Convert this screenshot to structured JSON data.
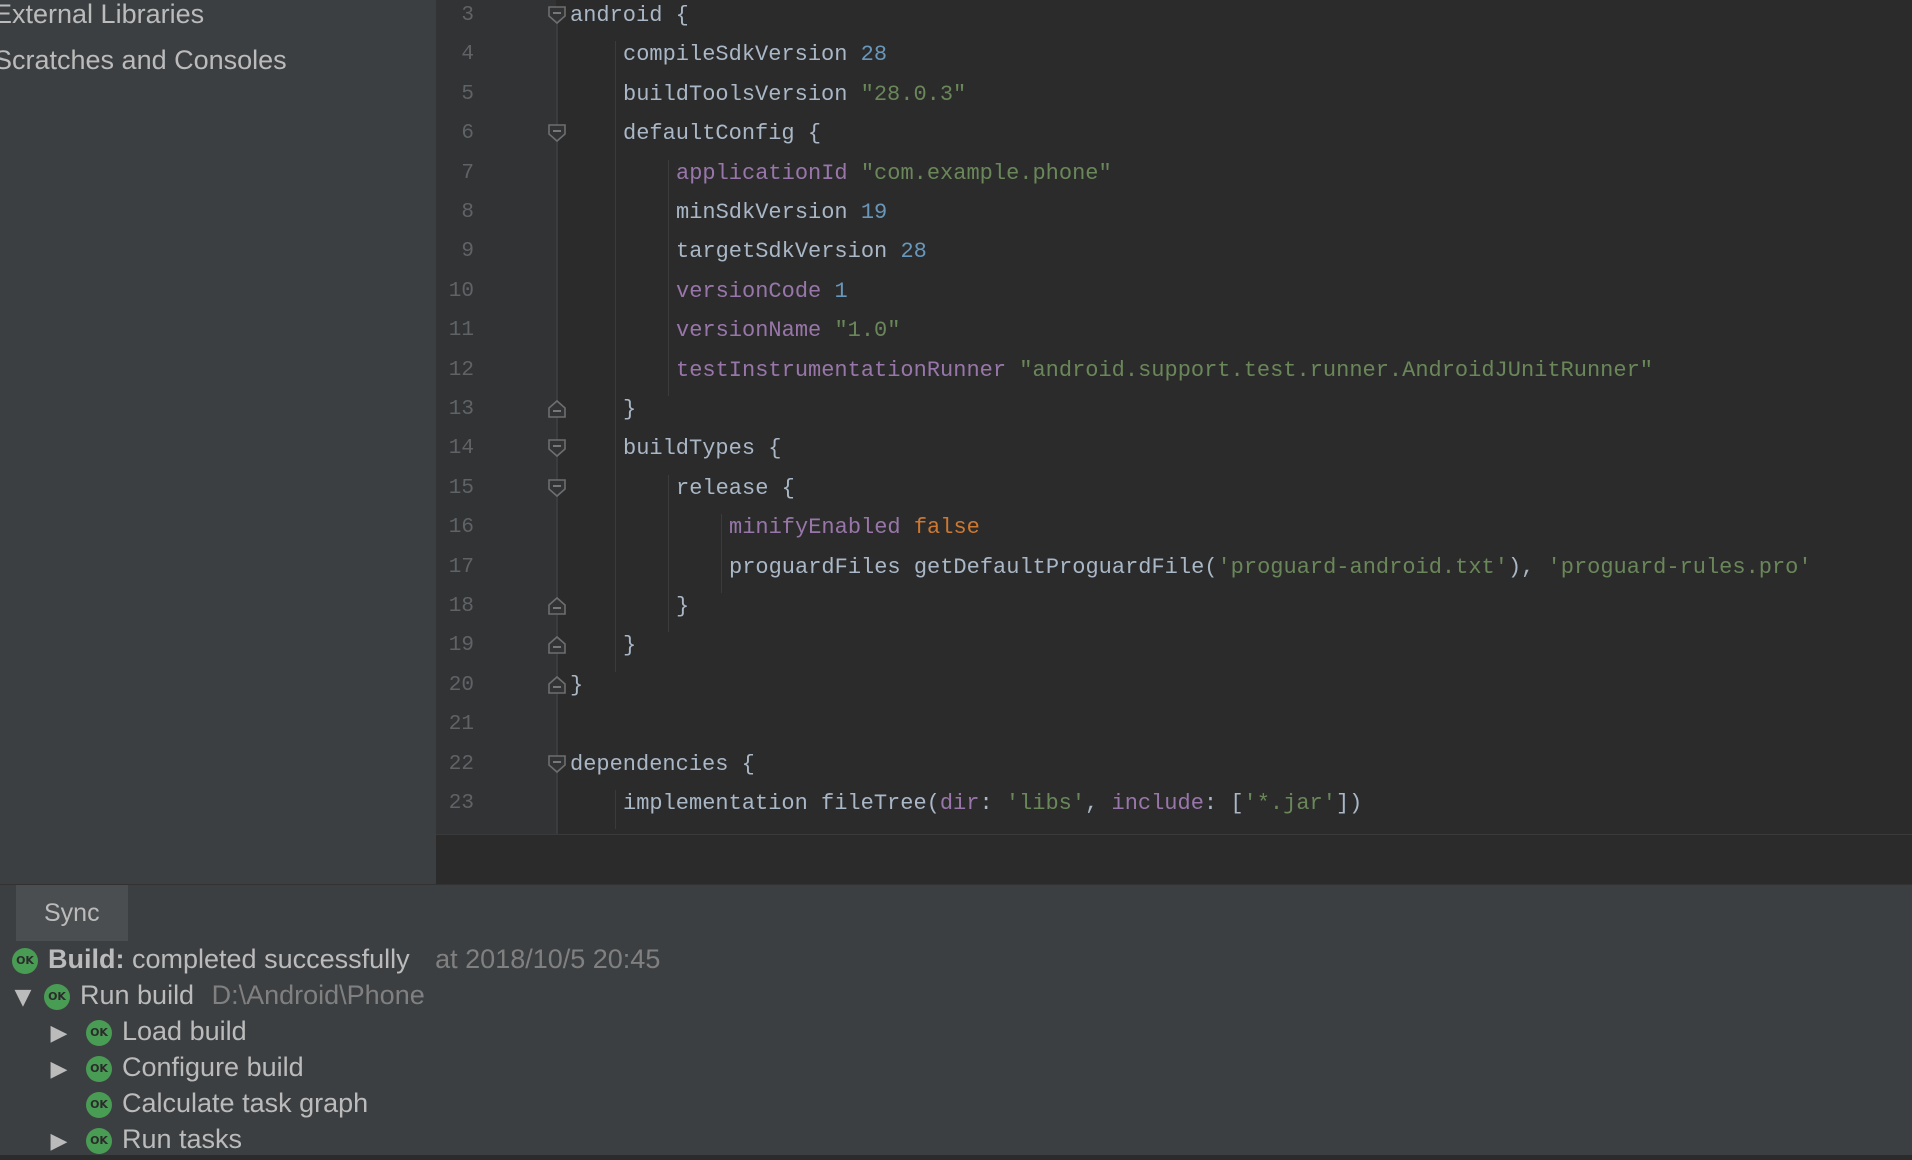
{
  "sidebar": {
    "items": [
      {
        "label": "External Libraries"
      },
      {
        "label": "Scratches and Consoles"
      }
    ]
  },
  "editor": {
    "lines": [
      {
        "n": "3",
        "indent": 0,
        "tokens": [
          [
            "kw",
            "android {"
          ]
        ],
        "fold": "open"
      },
      {
        "n": "4",
        "indent": 1,
        "tokens": [
          [
            "kw",
            "compileSdkVersion "
          ],
          [
            "num",
            "28"
          ]
        ]
      },
      {
        "n": "5",
        "indent": 1,
        "tokens": [
          [
            "kw",
            "buildToolsVersion "
          ],
          [
            "str",
            "\"28.0.3\""
          ]
        ]
      },
      {
        "n": "6",
        "indent": 1,
        "tokens": [
          [
            "kw",
            "defaultConfig {"
          ]
        ],
        "fold": "open"
      },
      {
        "n": "7",
        "indent": 2,
        "tokens": [
          [
            "prop",
            "applicationId "
          ],
          [
            "str",
            "\"com.example.phone\""
          ]
        ]
      },
      {
        "n": "8",
        "indent": 2,
        "tokens": [
          [
            "kw",
            "minSdkVersion "
          ],
          [
            "num",
            "19"
          ]
        ]
      },
      {
        "n": "9",
        "indent": 2,
        "tokens": [
          [
            "kw",
            "targetSdkVersion "
          ],
          [
            "num",
            "28"
          ]
        ]
      },
      {
        "n": "10",
        "indent": 2,
        "tokens": [
          [
            "prop",
            "versionCode "
          ],
          [
            "num",
            "1"
          ]
        ]
      },
      {
        "n": "11",
        "indent": 2,
        "tokens": [
          [
            "prop",
            "versionName "
          ],
          [
            "str",
            "\"1.0\""
          ]
        ]
      },
      {
        "n": "12",
        "indent": 2,
        "tokens": [
          [
            "prop",
            "testInstrumentationRunner "
          ],
          [
            "str",
            "\"android.support.test.runner.AndroidJUnitRunner\""
          ]
        ]
      },
      {
        "n": "13",
        "indent": 1,
        "tokens": [
          [
            "kw",
            "}"
          ]
        ],
        "fold": "close"
      },
      {
        "n": "14",
        "indent": 1,
        "tokens": [
          [
            "kw",
            "buildTypes {"
          ]
        ],
        "fold": "open"
      },
      {
        "n": "15",
        "indent": 2,
        "tokens": [
          [
            "kw",
            "release {"
          ]
        ],
        "fold": "open"
      },
      {
        "n": "16",
        "indent": 3,
        "tokens": [
          [
            "prop",
            "minifyEnabled "
          ],
          [
            "bool",
            "false"
          ]
        ]
      },
      {
        "n": "17",
        "indent": 3,
        "tokens": [
          [
            "kw",
            "proguardFiles getDefaultProguardFile("
          ],
          [
            "str",
            "'proguard-android.txt'"
          ],
          [
            "kw",
            "), "
          ],
          [
            "str",
            "'proguard-rules.pro'"
          ]
        ]
      },
      {
        "n": "18",
        "indent": 2,
        "tokens": [
          [
            "kw",
            "}"
          ]
        ],
        "fold": "close"
      },
      {
        "n": "19",
        "indent": 1,
        "tokens": [
          [
            "kw",
            "}"
          ]
        ],
        "fold": "close"
      },
      {
        "n": "20",
        "indent": 0,
        "tokens": [
          [
            "kw",
            "}"
          ]
        ],
        "fold": "close"
      },
      {
        "n": "21",
        "indent": 0,
        "tokens": []
      },
      {
        "n": "22",
        "indent": 0,
        "tokens": [
          [
            "kw",
            "dependencies {"
          ]
        ],
        "fold": "open"
      },
      {
        "n": "23",
        "indent": 1,
        "tokens": [
          [
            "kw",
            "implementation fileTree("
          ],
          [
            "prop",
            "dir"
          ],
          [
            "kw",
            ": "
          ],
          [
            "str",
            "'libs'"
          ],
          [
            "kw",
            ", "
          ],
          [
            "prop",
            "include"
          ],
          [
            "kw",
            ": ["
          ],
          [
            "str",
            "'*.jar'"
          ],
          [
            "kw",
            "])"
          ]
        ]
      }
    ]
  },
  "build": {
    "tab_label": "Sync",
    "ok_badge": "OK",
    "status": {
      "label": "Build:",
      "text": "completed successfully",
      "time": "at 2018/10/5 20:45"
    },
    "run": {
      "label": "Run build",
      "path": "D:\\Android\\Phone"
    },
    "tasks": [
      {
        "label": "Load build",
        "expandable": true
      },
      {
        "label": "Configure build",
        "expandable": true
      },
      {
        "label": "Calculate task graph",
        "expandable": false
      },
      {
        "label": "Run tasks",
        "expandable": true
      }
    ]
  },
  "colors": {
    "ok_green": "#499c54",
    "keyword": "#a9b7c6",
    "property": "#9876aa",
    "number": "#6897bb",
    "string": "#6a8759",
    "boolean": "#cc7832"
  }
}
